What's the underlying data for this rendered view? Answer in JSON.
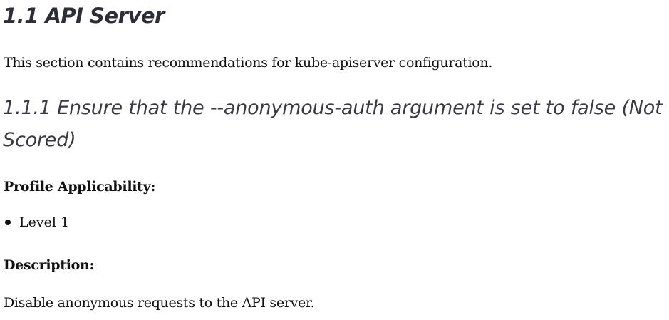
{
  "document": {
    "section_title": "1.1 API Server",
    "section_intro": "This section contains recommendations  for kube-apiserver  configuration.",
    "recommendation_title": "1.1.1 Ensure that the --anonymous-auth argument is set to false (Not Scored)",
    "profile_label": "Profile Applicability:",
    "profile_items": [
      "Level 1"
    ],
    "description_label": "Description:",
    "description_text": "Disable anonymous requests to the API server."
  }
}
